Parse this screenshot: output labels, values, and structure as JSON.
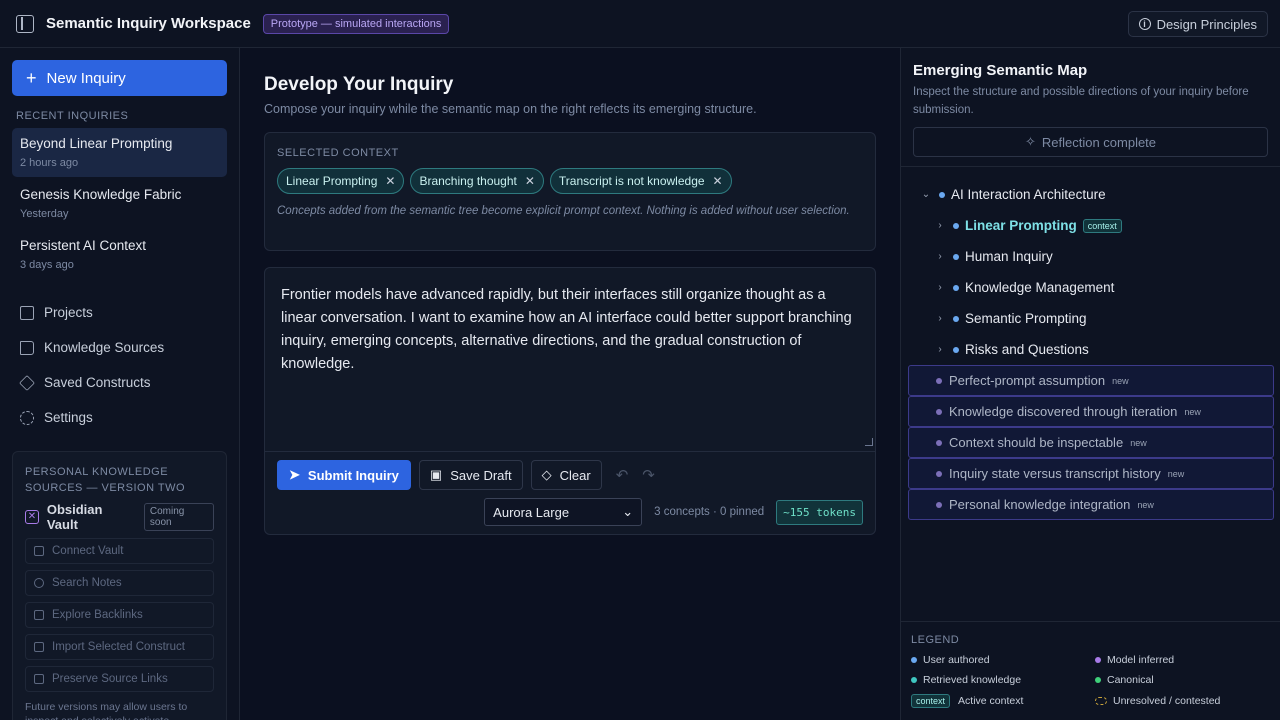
{
  "header": {
    "title": "Semantic Inquiry Workspace",
    "badge": "Prototype — simulated interactions",
    "design_principles": "Design Principles"
  },
  "sidebar": {
    "new_inquiry": "New Inquiry",
    "recent_label": "RECENT INQUIRIES",
    "recent": [
      {
        "title": "Beyond Linear Prompting",
        "time": "2 hours ago"
      },
      {
        "title": "Genesis Knowledge Fabric",
        "time": "Yesterday"
      },
      {
        "title": "Persistent AI Context",
        "time": "3 days ago"
      }
    ],
    "nav": [
      {
        "label": "Projects",
        "icon": "folder-icon"
      },
      {
        "label": "Knowledge Sources",
        "icon": "book-icon"
      },
      {
        "label": "Saved Constructs",
        "icon": "cubes-icon"
      },
      {
        "label": "Settings",
        "icon": "gear-icon"
      }
    ],
    "pks": {
      "heading": "PERSONAL KNOWLEDGE SOURCES — VERSION TWO",
      "vault_name": "Obsidian Vault",
      "coming_soon": "Coming soon",
      "actions": [
        "Connect Vault",
        "Search Notes",
        "Explore Backlinks",
        "Import Selected Construct",
        "Preserve Source Links"
      ],
      "footer": "Future versions may allow users to inspect and selectively activate knowledge from personal knowledge"
    }
  },
  "main": {
    "title": "Develop Your Inquiry",
    "subtitle": "Compose your inquiry while the semantic map on the right reflects its emerging structure.",
    "context_label": "SELECTED CONTEXT",
    "chips": [
      "Linear Prompting",
      "Branching thought",
      "Transcript is not knowledge"
    ],
    "context_note": "Concepts added from the semantic tree become explicit prompt context. Nothing is added without user selection.",
    "editor_text": "Frontier models have advanced rapidly, but their interfaces still organize thought as a linear conversation. I want to examine how an AI interface could better support branching inquiry, emerging concepts, alternative directions, and the gradual construction of knowledge.",
    "submit": "Submit Inquiry",
    "save_draft": "Save Draft",
    "clear": "Clear",
    "model": "Aurora Large",
    "stats": "3 concepts · 0 pinned",
    "tokens": "~155 tokens"
  },
  "map": {
    "title": "Emerging Semantic Map",
    "description": "Inspect the structure and possible directions of your inquiry before submission.",
    "reflection": "Reflection complete",
    "root": "AI Interaction Architecture",
    "children": [
      {
        "label": "Linear Prompting",
        "tag": "context"
      },
      {
        "label": "Human Inquiry"
      },
      {
        "label": "Knowledge Management"
      },
      {
        "label": "Semantic Prompting"
      },
      {
        "label": "Risks and Questions"
      }
    ],
    "inferred": [
      "Perfect-prompt assumption",
      "Knowledge discovered through iteration",
      "Context should be inspectable",
      "Inquiry state versus transcript history",
      "Personal knowledge integration"
    ],
    "new_tag": "new",
    "legend": {
      "title": "LEGEND",
      "user_authored": "User authored",
      "model_inferred": "Model inferred",
      "retrieved": "Retrieved knowledge",
      "canonical": "Canonical",
      "context_tag": "context",
      "active_context": "Active context",
      "unresolved": "Unresolved / contested"
    }
  },
  "colors": {
    "accent": "#2d64e0",
    "user_authored": "#6aa8f0",
    "model_inferred": "#a87be8",
    "retrieved": "#3fc6c0",
    "canonical": "#3fd07a",
    "unresolved": "#c8a33a"
  }
}
